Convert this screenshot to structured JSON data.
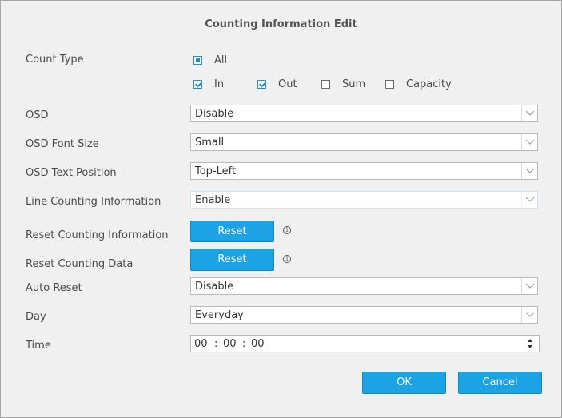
{
  "dialog": {
    "title": "Counting Information Edit"
  },
  "count_type": {
    "label": "Count Type",
    "all": {
      "label": "All",
      "checked": true
    },
    "in": {
      "label": "In",
      "checked": true
    },
    "out": {
      "label": "Out",
      "checked": true
    },
    "sum": {
      "label": "Sum",
      "checked": false
    },
    "capacity": {
      "label": "Capacity",
      "checked": false
    }
  },
  "osd": {
    "label": "OSD",
    "value": "Disable"
  },
  "osd_font_size": {
    "label": "OSD Font Size",
    "value": "Small"
  },
  "osd_text_position": {
    "label": "OSD Text Position",
    "value": "Top-Left"
  },
  "line_counting": {
    "label": "Line Counting Information",
    "value": "Enable"
  },
  "reset_info": {
    "label": "Reset Counting Information",
    "button": "Reset",
    "info_icon": "info-icon"
  },
  "reset_data": {
    "label": "Reset Counting Data",
    "button": "Reset",
    "info_icon": "info-icon"
  },
  "auto_reset": {
    "label": "Auto Reset",
    "value": "Disable"
  },
  "day": {
    "label": "Day",
    "value": "Everyday"
  },
  "time": {
    "label": "Time",
    "hours": "00",
    "minutes": "00",
    "seconds": "00",
    "sep": ":"
  },
  "footer": {
    "ok": "OK",
    "cancel": "Cancel"
  },
  "colors": {
    "accent": "#1ba3e5",
    "background": "#f0f0f0"
  }
}
